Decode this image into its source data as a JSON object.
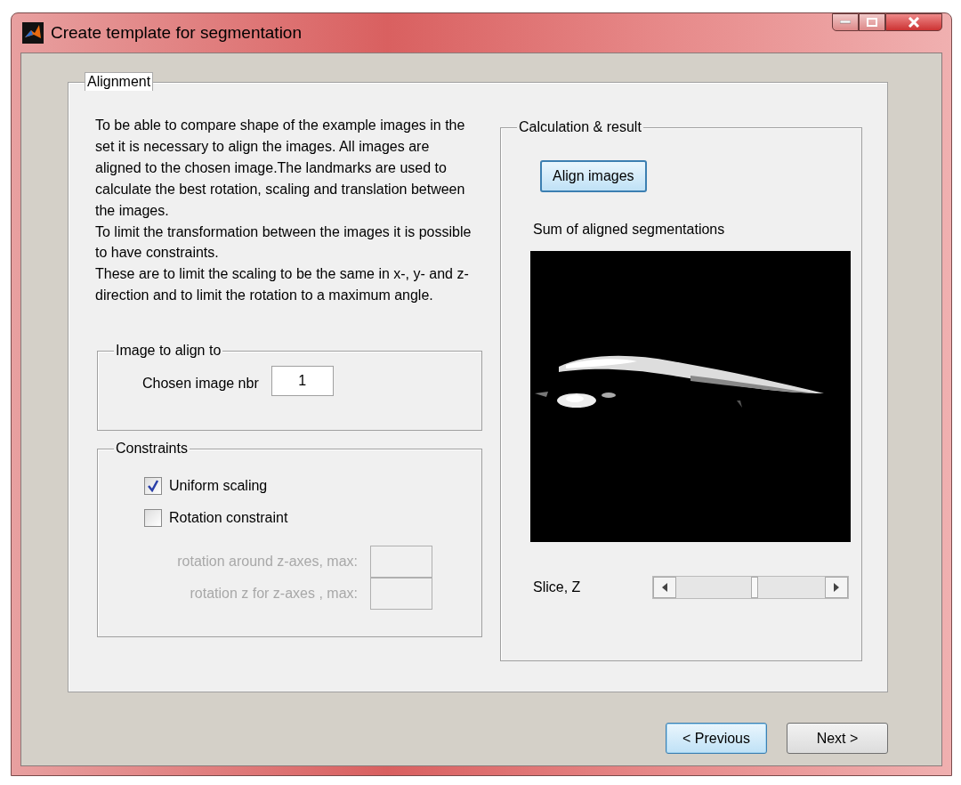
{
  "window": {
    "title": "Create template for segmentation"
  },
  "alignment": {
    "title": "Alignment",
    "description": "To be able to compare shape of the example images in the set it is necessary to align the images. All images are aligned to the chosen image.The landmarks are used to calculate the best rotation, scaling and translation between the images.\nTo limit the transformation between the images it is possible to have constraints.\nThese are to limit the scaling to be the same in x-, y- and z- direction and to limit the rotation to a maximum angle.",
    "image_group": {
      "title": "Image to align to",
      "label": "Chosen image nbr",
      "value": "1"
    },
    "constraints": {
      "title": "Constraints",
      "options": [
        {
          "label": "Uniform scaling",
          "checked": true
        },
        {
          "label": "Rotation constraint",
          "checked": false
        }
      ],
      "fields": [
        {
          "label": "rotation around z-axes, max:",
          "disabled": true
        },
        {
          "label": "rotation z for z-axes , max:",
          "disabled": true
        }
      ]
    },
    "result": {
      "title": "Calculation & result",
      "button": {
        "label": "Align images",
        "default": true
      },
      "image_label": "Sum of aligned segmentations",
      "slider": {
        "label": "Slice, Z",
        "level": 0.53
      }
    }
  },
  "buttons": [
    {
      "label": "< Previous",
      "default": true
    },
    {
      "label": "Next >",
      "default": false
    }
  ]
}
